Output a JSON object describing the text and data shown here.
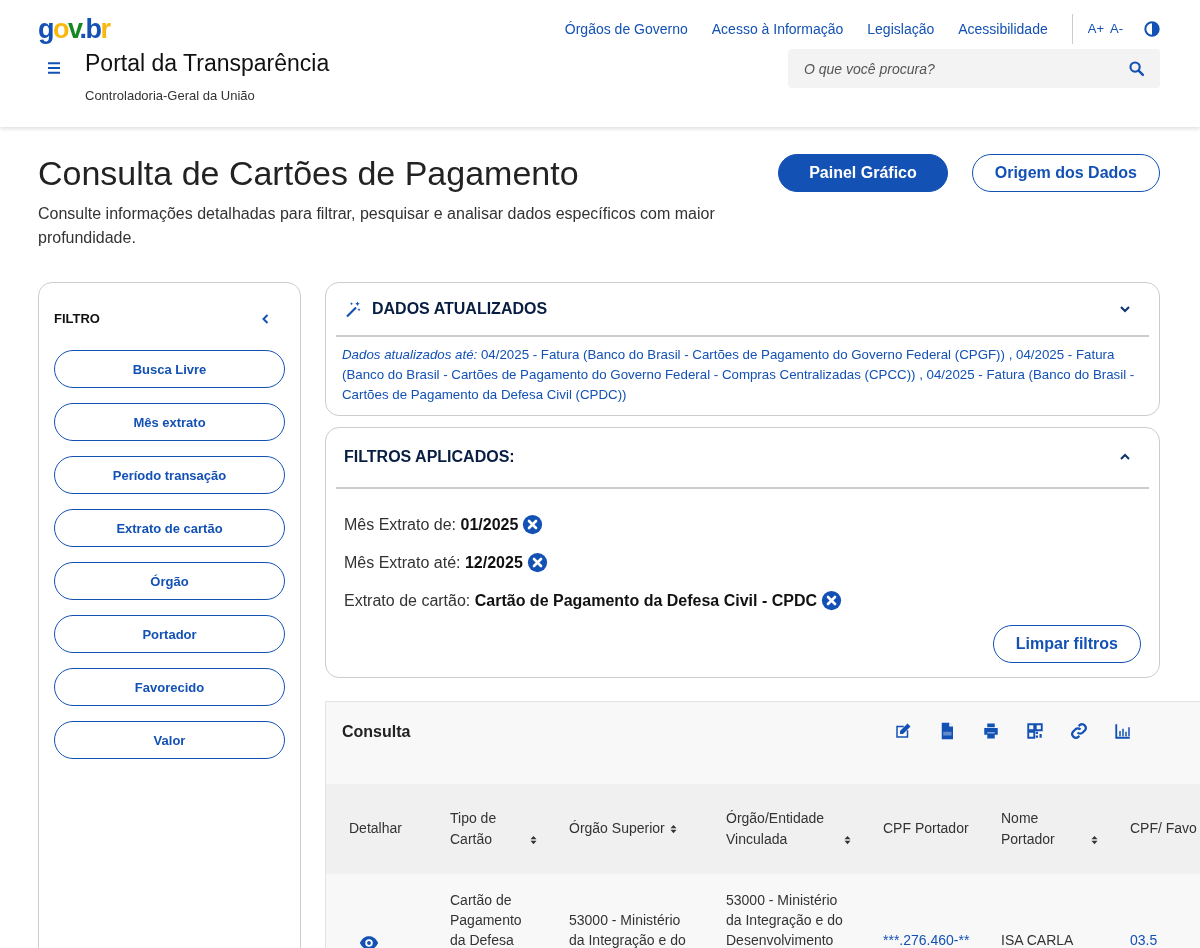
{
  "header": {
    "logo": "gov.br",
    "top_links": [
      "Órgãos de Governo",
      "Acesso à Informação",
      "Legislação",
      "Acessibilidade"
    ],
    "font_controls": [
      "A+",
      "A-"
    ],
    "site_title": "Portal da Transparência",
    "site_subtitle": "Controladoria-Geral da União",
    "search": {
      "placeholder": "O que você procura?"
    }
  },
  "page": {
    "title": "Consulta de Cartões de Pagamento",
    "description": "Consulte informações detalhadas para filtrar, pesquisar e analisar dados específicos com maior profundidade.",
    "buttons": [
      {
        "label": "Painel Gráfico",
        "kind": "primary"
      },
      {
        "label": "Origem dos Dados",
        "kind": "outline"
      }
    ]
  },
  "filter": {
    "title": "FILTRO",
    "items": [
      "Busca Livre",
      "Mês extrato",
      "Período transação",
      "Extrato de cartão",
      "Órgão",
      "Portador",
      "Favorecido",
      "Valor"
    ]
  },
  "dados_atualizados": {
    "title": "DADOS ATUALIZADOS",
    "expanded": false,
    "text": "*Dados atualizados até:* 04/2025 - Fatura (Banco do Brasil - Cartões de Pagamento do Governo Federal (CPGF)) , 04/2025 - Fatura (Banco do Brasil - Cartões de Pagamento do Governo Federal - Compras Centralizadas (CPCC)) , 04/2025 - Fatura (Banco do Brasil - Cartões de Pagamento da Defesa Civil (CPDC))"
  },
  "filtros_aplicados": {
    "title": "FILTROS APLICADOS:",
    "expanded": true,
    "items": [
      {
        "label": "Mês Extrato de:",
        "value": "01/2025"
      },
      {
        "label": "Mês Extrato até:",
        "value": "12/2025"
      },
      {
        "label": "Extrato de cartão:",
        "value": "Cartão de Pagamento da Defesa Civil - CPDC"
      }
    ],
    "button": "Limpar filtros"
  },
  "consulta": {
    "title": "Consulta",
    "table": {
      "columns": [
        {
          "label": "Detalhar",
          "sortable": false
        },
        {
          "label": "Tipo de Cartão",
          "sortable": true
        },
        {
          "label": "Órgão Superior",
          "sortable": true
        },
        {
          "label": "Órgão/Entidade Vinculada",
          "sortable": true
        },
        {
          "label": "CPF Portador",
          "sortable": false
        },
        {
          "label": "Nome Portador",
          "sortable": true
        },
        {
          "label": "CPF/ Favo",
          "sortable": false
        }
      ],
      "rows": [
        {
          "cells": [
            {
              "kind": "action"
            },
            {
              "kind": "text",
              "text": "Cartão de Pagamento da Defesa"
            },
            {
              "kind": "text",
              "text": "53000 - Ministério da Integração e do"
            },
            {
              "kind": "text",
              "text": "53000 - Ministério da Integração e do Desenvolvimento"
            },
            {
              "kind": "link",
              "text": "***.276.460-**"
            },
            {
              "kind": "text",
              "text": "ISA CARLA"
            },
            {
              "kind": "link",
              "text": "03.5"
            }
          ]
        }
      ]
    }
  }
}
